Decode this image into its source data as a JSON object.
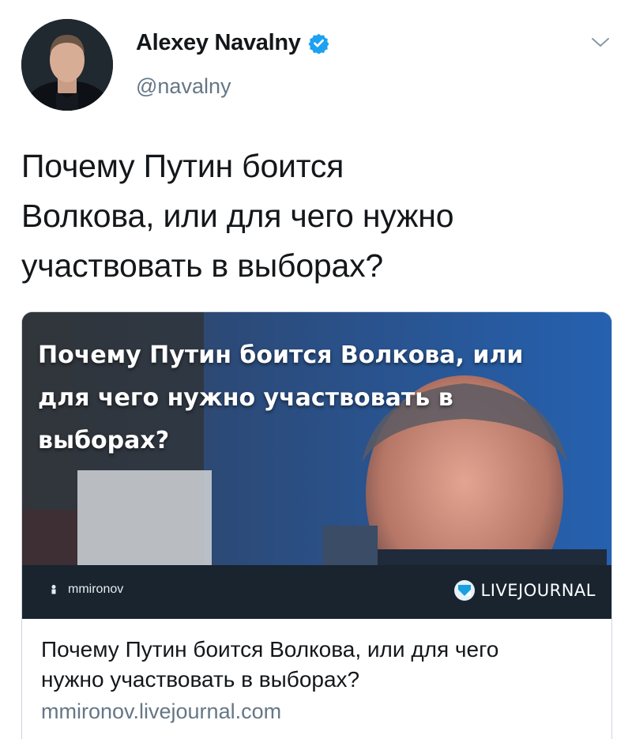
{
  "author": {
    "display_name": "Alexey Navalny",
    "handle": "@navalny",
    "verified": true
  },
  "tweet": {
    "text_lines": [
      "Почему Путин боится",
      "Волкова, или для чего нужно",
      "участвовать в выборах?"
    ]
  },
  "link_card": {
    "overlay_title_lines": [
      "Почему Путин боится Волкова, или",
      "для чего нужно участвовать в",
      "выборах?"
    ],
    "author_username": "mmironov",
    "brand": "LIVEJOURNAL",
    "title_lines": [
      "Почему Путин боится Волкова, или для чего",
      "нужно участвовать в выборах?"
    ],
    "domain": "mmironov.livejournal.com"
  },
  "icons": {
    "verified": "verified-badge-icon",
    "caret": "chevron-down-icon",
    "user": "user-icon",
    "brand_logo": "livejournal-logo-icon"
  },
  "colors": {
    "verified_blue": "#1da1f2",
    "secondary_text": "#657786",
    "strip_bg": "#19242f"
  }
}
